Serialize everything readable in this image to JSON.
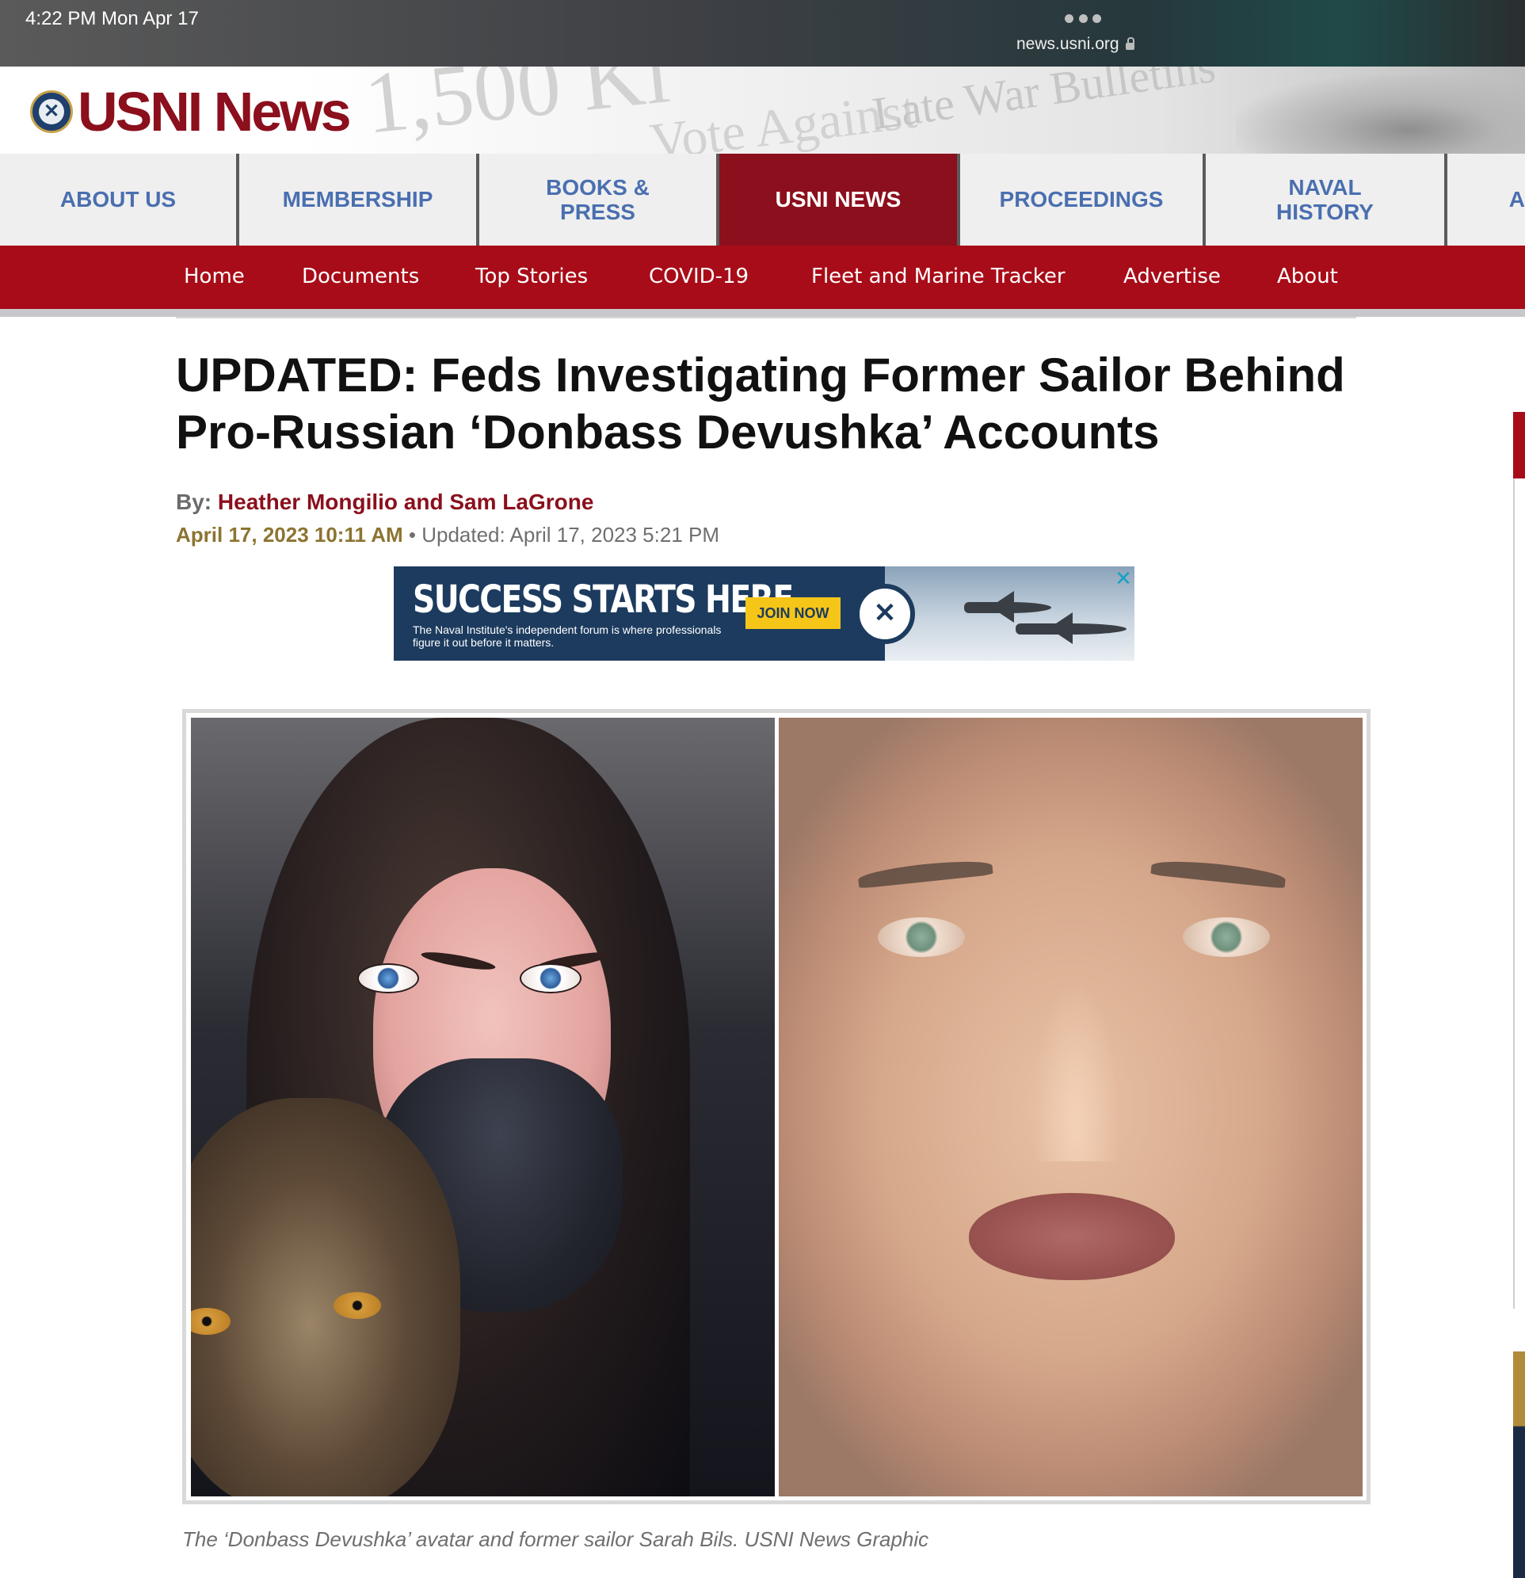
{
  "status_bar": {
    "time_date": "4:22 PM   Mon Apr 17",
    "url": "news.usni.org"
  },
  "header": {
    "logo_text": "USNI News",
    "background_texts": [
      "1,500 Ki",
      "Vote Against",
      "Late War Bulletins"
    ]
  },
  "primary_nav": [
    {
      "label": "ABOUT US",
      "active": false
    },
    {
      "label": "MEMBERSHIP",
      "active": false
    },
    {
      "label": "BOOKS & PRESS",
      "active": false
    },
    {
      "label": "USNI NEWS",
      "active": true
    },
    {
      "label": "PROCEEDINGS",
      "active": false
    },
    {
      "label": "NAVAL HISTORY",
      "active": false
    },
    {
      "label": "A",
      "active": false
    }
  ],
  "secondary_nav": [
    "Home",
    "Documents",
    "Top Stories",
    "COVID-19",
    "Fleet and Marine Tracker",
    "Advertise",
    "About"
  ],
  "article": {
    "headline": "UPDATED: Feds Investigating Former Sailor Behind Pro-Russian ‘Donbass Devushka’ Accounts",
    "by_label": "By:",
    "authors": "Heather Mongilio and Sam LaGrone",
    "published": "April 17, 2023 10:11 AM",
    "updated": "• Updated: April 17, 2023 5:21 PM",
    "caption": "The ‘Donbass Devushka’ avatar and former sailor Sarah Bils. USNI News Graphic"
  },
  "ad": {
    "headline": "SUCCESS STARTS HERE",
    "subtext": "The Naval Institute's independent forum is where professionals figure it out before it matters.",
    "button": "JOIN NOW",
    "close_icon": "✕"
  },
  "colors": {
    "brand_red": "#8b0f1c",
    "nav_red": "#a80c18",
    "nav_blue": "#4a6fb0",
    "date_gold": "#8c7431",
    "ad_navy": "#1c3b5e"
  }
}
